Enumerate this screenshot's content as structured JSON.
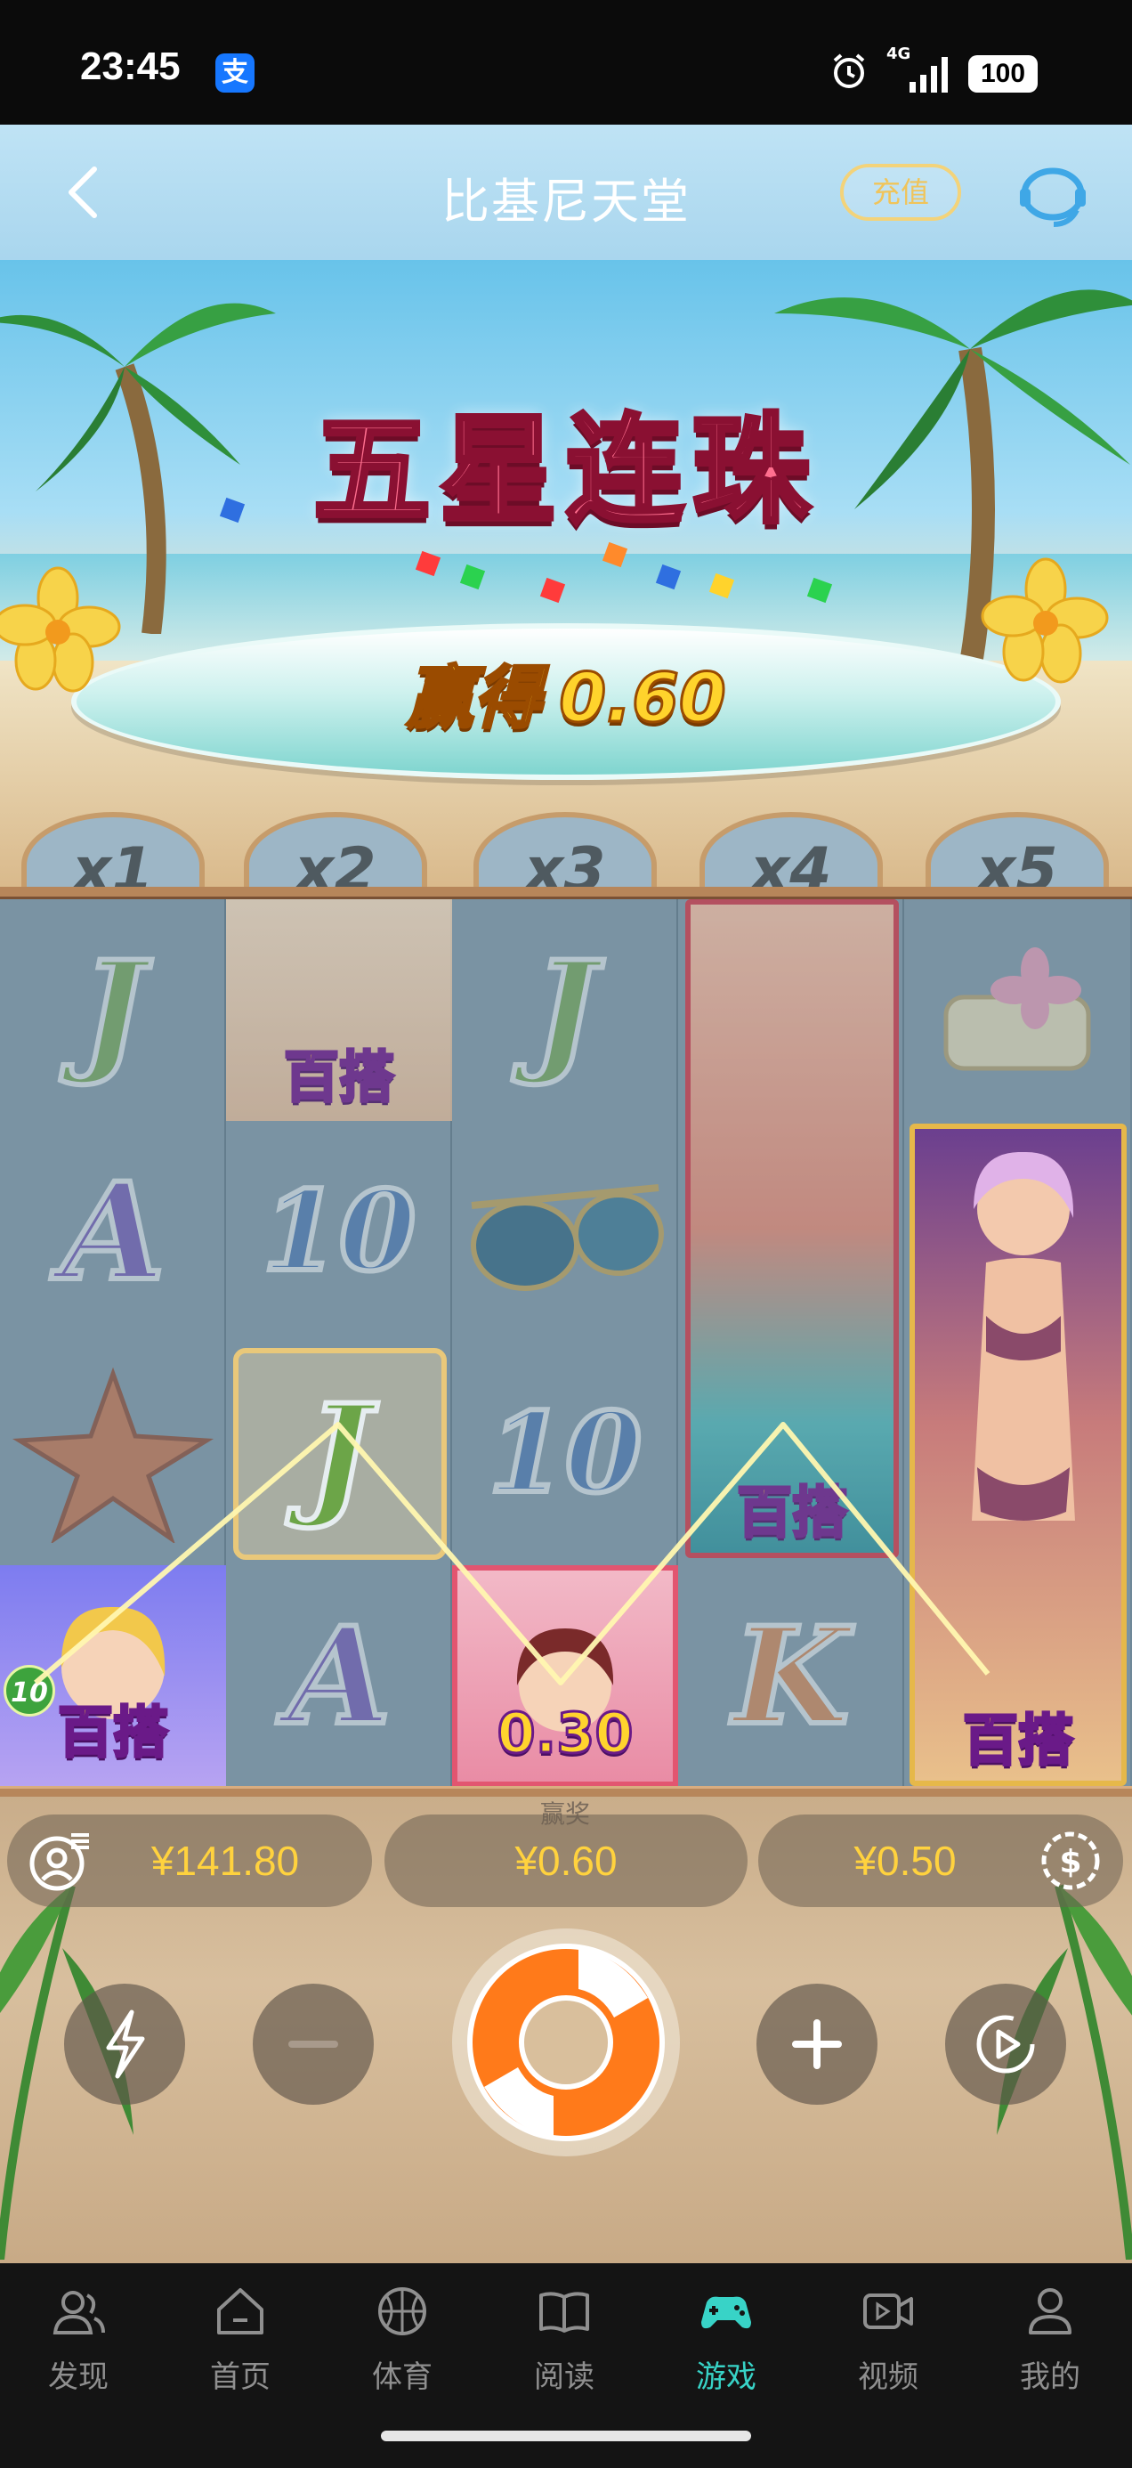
{
  "status_bar": {
    "time": "23:45",
    "alipay_icon_text": "支",
    "network": "4G",
    "battery": "100"
  },
  "header": {
    "title": "比基尼天堂",
    "recharge_label": "充值"
  },
  "banner": {
    "combo_title": "五星连珠",
    "win_label": "赢得",
    "win_amount": "0.60",
    "multipliers": [
      "x1",
      "x2",
      "x3",
      "x4",
      "x5"
    ]
  },
  "reels": {
    "symbols": {
      "r1c1": "J",
      "r2c1": "A",
      "r4c1_tag": "百搭",
      "r4c1_count": "10",
      "r1c2_tag": "百搭",
      "r2c2": "10",
      "r3c2": "J",
      "r4c2": "A",
      "r1c3": "J",
      "r3c3": "10",
      "r4c3_payout": "0.30",
      "reel4_tag": "百搭",
      "r4c4": "K",
      "reel5_tag": "百搭"
    }
  },
  "controls": {
    "balance": "¥141.80",
    "win_caption": "赢奖",
    "win_value": "¥0.60",
    "bet": "¥0.50"
  },
  "tabbar": {
    "items": [
      {
        "label": "发现",
        "icon": "people-icon"
      },
      {
        "label": "首页",
        "icon": "home-icon"
      },
      {
        "label": "体育",
        "icon": "basketball-icon"
      },
      {
        "label": "阅读",
        "icon": "book-icon"
      },
      {
        "label": "游戏",
        "icon": "gamepad-icon"
      },
      {
        "label": "视频",
        "icon": "video-icon"
      },
      {
        "label": "我的",
        "icon": "user-icon"
      }
    ],
    "active_index": 4,
    "active_color": "#38d3c7",
    "inactive_color": "#8f8f8f"
  }
}
